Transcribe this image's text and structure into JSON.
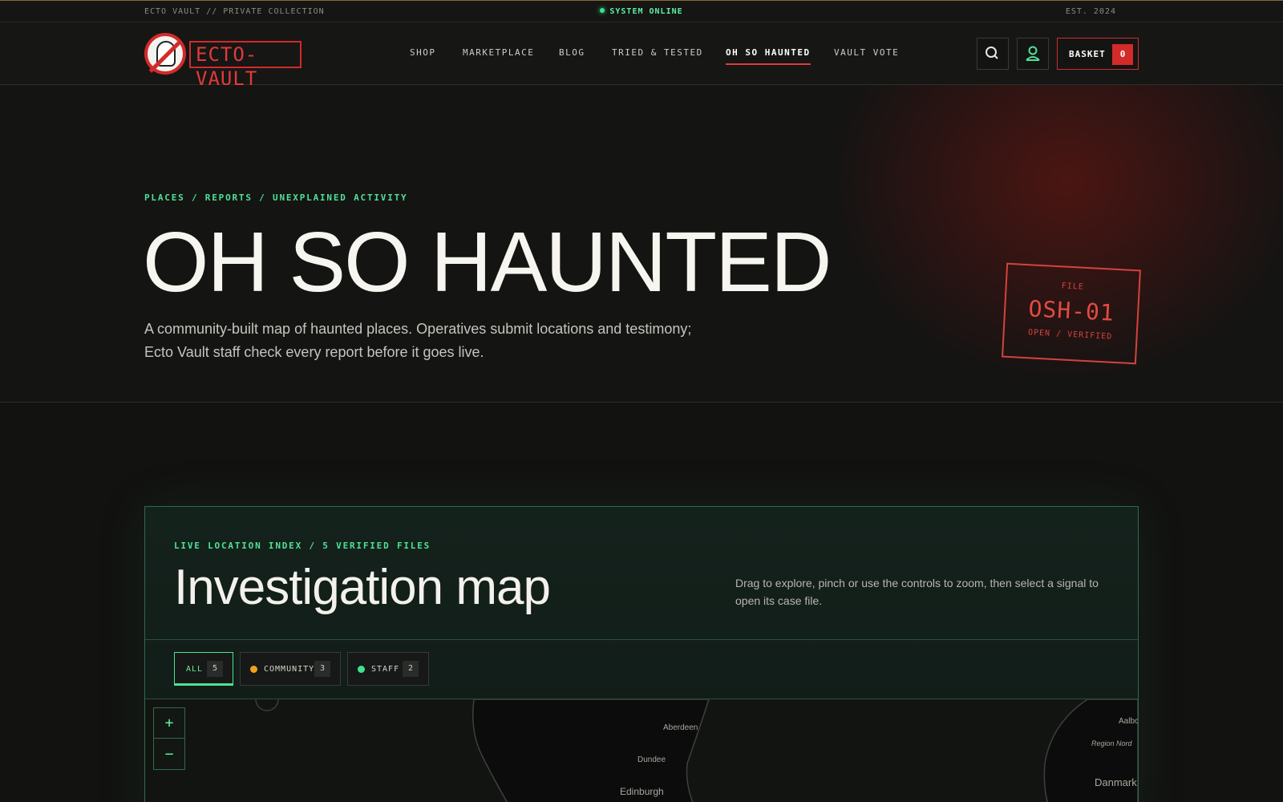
{
  "topbar": {
    "left": "ECTO VAULT // PRIVATE COLLECTION",
    "center": "SYSTEM ONLINE",
    "right": "EST. 2024",
    "status_color": "#3fe38c"
  },
  "header": {
    "logo_text": "ECTO-VAULT",
    "nav": [
      {
        "label": "SHOP"
      },
      {
        "label": "MARKETPLACE"
      },
      {
        "label": "BLOG"
      },
      {
        "label": "TRIED & TESTED"
      },
      {
        "label": "OH SO HAUNTED",
        "active": true
      },
      {
        "label": "VAULT VOTE"
      }
    ],
    "icons": {
      "search": "search-icon",
      "account": "user-icon"
    },
    "basket": {
      "label": "BASKET",
      "count": "0"
    },
    "accent": "#d32a2a"
  },
  "hero": {
    "breadcrumb": "PLACES / REPORTS / UNEXPLAINED ACTIVITY",
    "title": "OH SO HAUNTED",
    "description": "A community-built map of haunted places. Operatives submit locations and testimony; Ecto Vault staff check every report before it goes live.",
    "stamp": {
      "label": "FILE",
      "code": "OSH-01",
      "status": "OPEN / VERIFIED"
    }
  },
  "map_panel": {
    "eyebrow": "LIVE LOCATION INDEX / 5 VERIFIED FILES",
    "title": "Investigation map",
    "help": "Drag to explore, pinch or use the controls to zoom, then select a signal to open its case file.",
    "filters": [
      {
        "label": "ALL",
        "count": "5",
        "active": true
      },
      {
        "label": "COMMUNITY",
        "count": "3",
        "color": "#f0a020"
      },
      {
        "label": "STAFF",
        "count": "2",
        "color": "#3fe38c"
      }
    ],
    "zoom": {
      "in": "+",
      "out": "−"
    },
    "places": [
      "Aberdeen",
      "Dundee",
      "Edinburgh",
      "Aalbo",
      "Region Nord",
      "Danmark"
    ]
  }
}
